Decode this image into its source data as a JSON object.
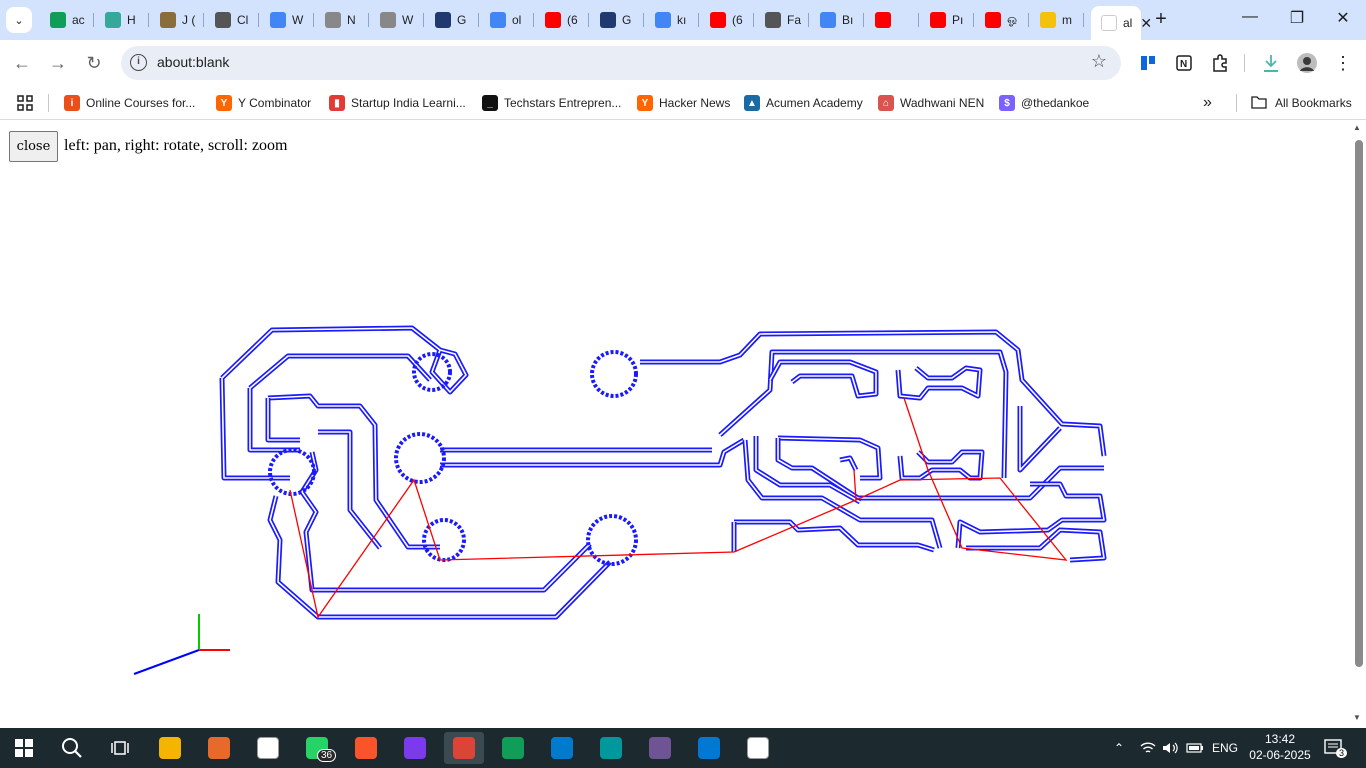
{
  "browser": {
    "tabs": [
      {
        "label": "ac",
        "icon": "sheets-icon",
        "color": "#0f9d58"
      },
      {
        "label": "H",
        "icon": "triangle-icon",
        "color": "#34a89a"
      },
      {
        "label": "J (",
        "icon": "avatar-icon",
        "color": "#8a6d3b"
      },
      {
        "label": "Cl",
        "icon": "chatgpt-icon",
        "color": "#555555"
      },
      {
        "label": "W",
        "icon": "google-icon",
        "color": "#4285f4"
      },
      {
        "label": "N",
        "icon": "w-icon",
        "color": "#888888"
      },
      {
        "label": "W",
        "icon": "w-icon",
        "color": "#888888"
      },
      {
        "label": "G",
        "icon": "r-icon",
        "color": "#1e3a6e"
      },
      {
        "label": "ol",
        "icon": "google-icon",
        "color": "#4285f4"
      },
      {
        "label": "(6",
        "icon": "youtube-icon",
        "color": "#ff0000"
      },
      {
        "label": "G",
        "icon": "r-icon",
        "color": "#1e3a6e"
      },
      {
        "label": "kı",
        "icon": "google-icon",
        "color": "#4285f4"
      },
      {
        "label": "(6",
        "icon": "youtube-icon",
        "color": "#ff0000"
      },
      {
        "label": "Fa",
        "icon": "chatgpt-icon",
        "color": "#555555"
      },
      {
        "label": "Bı",
        "icon": "google-icon",
        "color": "#4285f4"
      },
      {
        "label": "",
        "icon": "youtube-icon",
        "color": "#ff0000"
      },
      {
        "label": "Pı",
        "icon": "youtube-icon",
        "color": "#ff0000"
      },
      {
        "label": "ஓ",
        "icon": "youtube-icon",
        "color": "#ff0000"
      },
      {
        "label": "m",
        "icon": "sunglasses-emoji-icon",
        "color": "#f4c20d"
      },
      {
        "label": "al",
        "icon": "blank-icon",
        "color": "#ffffff"
      }
    ],
    "url": "about:blank",
    "bookmarks": [
      {
        "label": "Online Courses for...",
        "color": "#e94e1b",
        "glyph": "i"
      },
      {
        "label": "Y Combinator",
        "color": "#ff6600",
        "glyph": "Y"
      },
      {
        "label": "Startup India Learni...",
        "color": "#e53935",
        "glyph": "▮"
      },
      {
        "label": "Techstars Entrepren...",
        "color": "#111111",
        "glyph": "_"
      },
      {
        "label": "Hacker News",
        "color": "#ff6600",
        "glyph": "Y"
      },
      {
        "label": "Acumen Academy",
        "color": "#1a6aa6",
        "glyph": "▲"
      },
      {
        "label": "Wadhwani NEN",
        "color": "#d9534f",
        "glyph": "⌂"
      },
      {
        "label": "@thedankoe",
        "color": "#7b61ff",
        "glyph": "$"
      }
    ],
    "all_bookmarks": "All Bookmarks"
  },
  "page": {
    "close_label": "close",
    "hint": "left: pan, right: rotate, scroll: zoom"
  },
  "taskbar": {
    "apps": [
      {
        "icon": "file-explorer-icon",
        "color": "#f4b400"
      },
      {
        "icon": "app-icon",
        "color": "#e86a2b"
      },
      {
        "icon": "notion-icon",
        "color": "#ffffff"
      },
      {
        "icon": "whatsapp-icon",
        "color": "#25d366",
        "badge": "36"
      },
      {
        "icon": "brave-icon",
        "color": "#fb542b"
      },
      {
        "icon": "obsidian-icon",
        "color": "#7c3aed"
      },
      {
        "icon": "chrome-icon",
        "color": "#db4437",
        "active": true
      },
      {
        "icon": "chrome-profile-icon",
        "color": "#0f9d58"
      },
      {
        "icon": "vscode-icon",
        "color": "#007acc"
      },
      {
        "icon": "arduino-icon",
        "color": "#00979d"
      },
      {
        "icon": "github-icon",
        "color": "#6e5494"
      },
      {
        "icon": "edge-icon",
        "color": "#0078d4"
      },
      {
        "icon": "app2-icon",
        "color": "#ffffff"
      }
    ],
    "language": "ENG",
    "time": "13:42",
    "date": "02-06-2025",
    "notifications": "3"
  },
  "colors": {
    "trace": "#1a1aff",
    "travel": "#ff0000",
    "axis_x": "#ff0000",
    "axis_y": "#00cc00",
    "axis_z": "#0000ff"
  }
}
